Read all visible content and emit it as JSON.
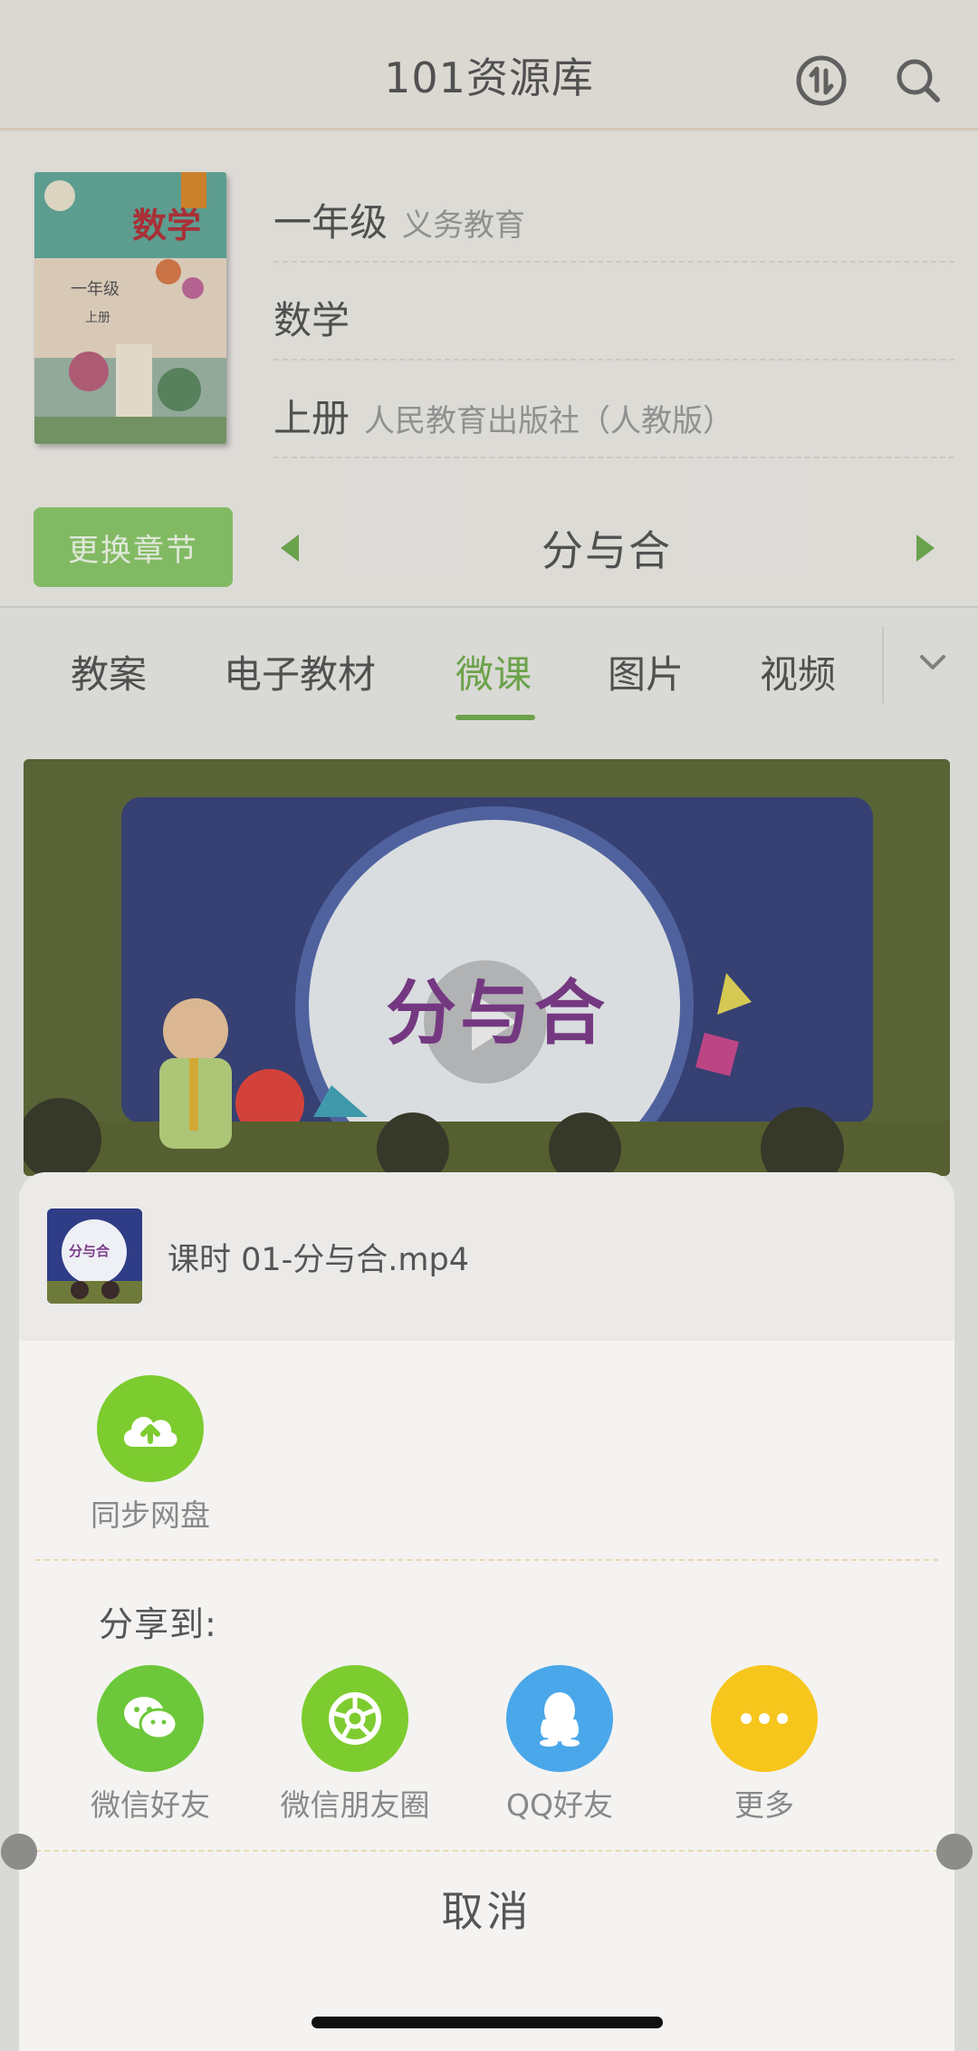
{
  "header": {
    "title": "101资源库",
    "icons": [
      "transfer-icon",
      "search-icon"
    ]
  },
  "book": {
    "cover_text": "数学",
    "cover_grade": "一年级",
    "cover_term": "上册",
    "grade": "一年级",
    "grade_sub": "义务教育",
    "subject": "数学",
    "volume": "上册",
    "publisher": "人民教育出版社（人教版）"
  },
  "chapter": {
    "change_label": "更换章节",
    "title": "分与合"
  },
  "tabs": [
    {
      "label": "教案",
      "active": false
    },
    {
      "label": "电子教材",
      "active": false
    },
    {
      "label": "微课",
      "active": true
    },
    {
      "label": "图片",
      "active": false
    },
    {
      "label": "视频",
      "active": false
    }
  ],
  "video": {
    "title": "分与合"
  },
  "sheet": {
    "file_name": "课时 01-分与合.mp4",
    "thumb_text": "分与合",
    "sync_label": "同步网盘",
    "share_to": "分享到:",
    "share_items": [
      {
        "label": "微信好友",
        "icon": "wechat-icon",
        "color": "#6cc83a"
      },
      {
        "label": "微信朋友圈",
        "icon": "moments-icon",
        "color": "#7dcc2f"
      },
      {
        "label": "QQ好友",
        "icon": "qq-icon",
        "color": "#4aa7ea"
      },
      {
        "label": "更多",
        "icon": "more-icon",
        "color": "#f7c61c"
      }
    ],
    "cancel_label": "取消"
  },
  "colors": {
    "accent_green": "#72ad4f",
    "button_green": "#8bc66a"
  }
}
